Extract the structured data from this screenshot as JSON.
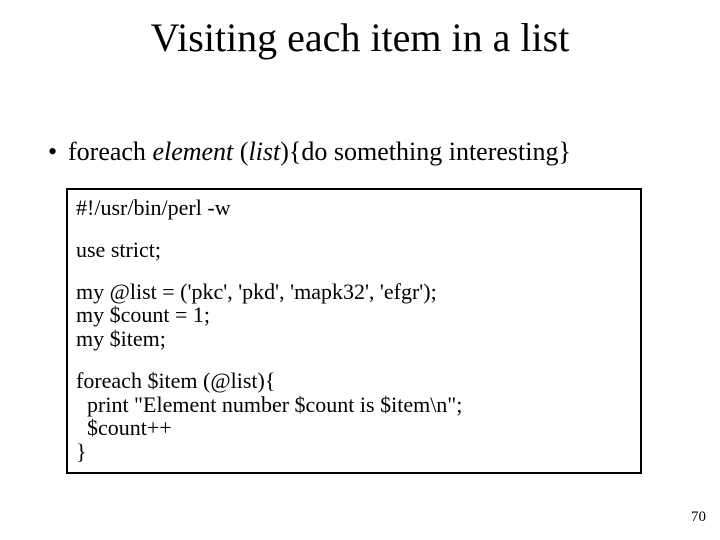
{
  "title": "Visiting each item in a list",
  "bullet": {
    "prefix": "foreach ",
    "italic1": "element",
    "mid": " (",
    "italic2": "list",
    "suffix": "){do something interesting}"
  },
  "code": {
    "l1": "#!/usr/bin/perl -w",
    "l2": "use strict;",
    "l3": "my @list = ('pkc', 'pkd', 'mapk32', 'efgr');",
    "l4": "my $count = 1;",
    "l5": "my $item;",
    "l6": "foreach $item (@list){",
    "l7": "  print \"Element number $count is $item\\n\";",
    "l8": "  $count++",
    "l9": "}"
  },
  "page_number": "70"
}
